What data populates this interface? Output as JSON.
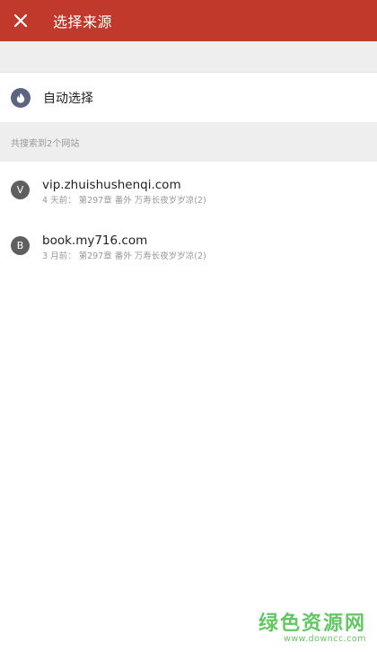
{
  "app_bar": {
    "title": "选择来源",
    "close_icon": "close-icon",
    "background": "#c0392b"
  },
  "auto_select": {
    "label": "自动选择",
    "icon": "flame-icon"
  },
  "section_header": "共搜索到2个网站",
  "sources": [
    {
      "initial": "V",
      "domain": "vip.zhuishushenqi.com",
      "meta": "4 天前： 第297章 番外 万寿长夜岁岁凉(2)"
    },
    {
      "initial": "B",
      "domain": "book.my716.com",
      "meta": "3 月前： 第297章 番外 万寿长夜岁岁凉(2)"
    }
  ],
  "watermark": {
    "text": "绿色资源网",
    "url": "www.downcc.com",
    "color": "#3dbb3d"
  }
}
